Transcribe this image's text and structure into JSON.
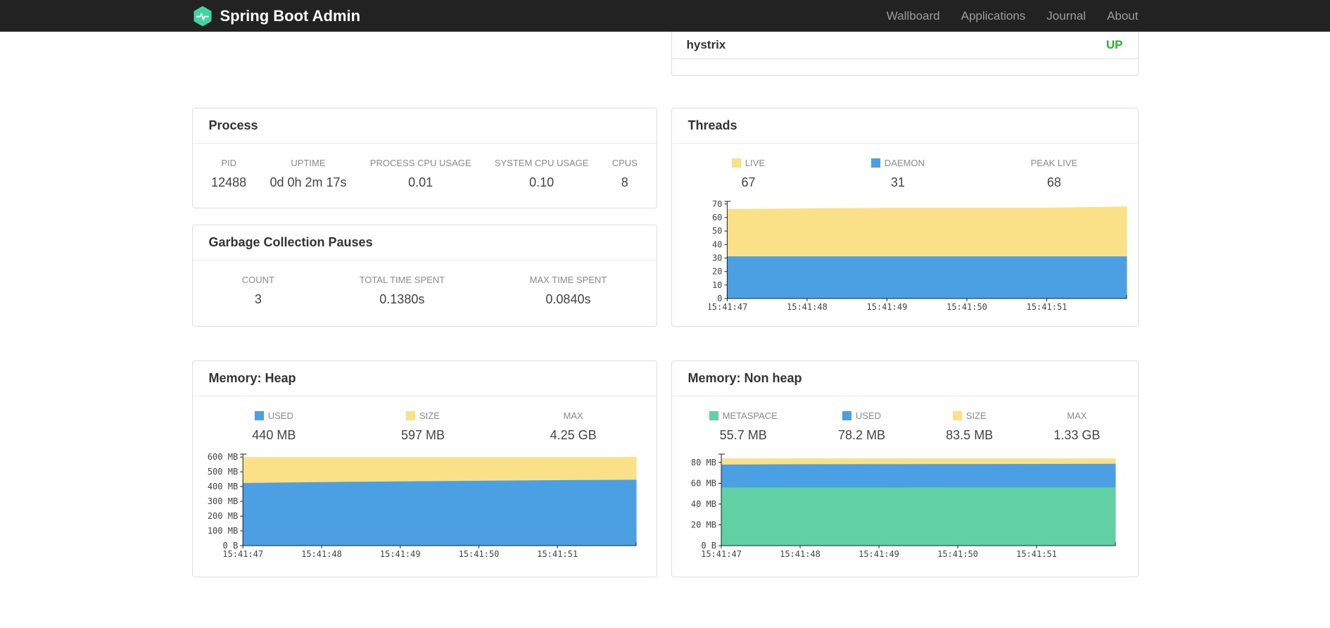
{
  "navbar": {
    "brand": "Spring Boot Admin",
    "items": [
      {
        "label": "Wallboard"
      },
      {
        "label": "Applications"
      },
      {
        "label": "Journal"
      },
      {
        "label": "About"
      }
    ]
  },
  "status_card": {
    "app_name": "hystrix",
    "status": "UP",
    "status_color": "#28b62c"
  },
  "colors": {
    "brand_green": "#42d3a2",
    "navbar_background": "#222222",
    "status_up": "#28b62c",
    "series_yellow": "#fae187",
    "series_blue": "#4aa0e2",
    "series_green": "#61d0a5"
  },
  "cards": {
    "process": {
      "title": "Process",
      "metrics": [
        {
          "label": "PID",
          "value": "12488"
        },
        {
          "label": "UPTIME",
          "value": "0d 0h 2m 17s"
        },
        {
          "label": "PROCESS CPU USAGE",
          "value": "0.01"
        },
        {
          "label": "SYSTEM CPU USAGE",
          "value": "0.10"
        },
        {
          "label": "CPUS",
          "value": "8"
        }
      ]
    },
    "gc": {
      "title": "Garbage Collection Pauses",
      "metrics": [
        {
          "label": "COUNT",
          "value": "3"
        },
        {
          "label": "TOTAL TIME SPENT",
          "value": "0.1380s"
        },
        {
          "label": "MAX TIME SPENT",
          "value": "0.0840s"
        }
      ]
    },
    "threads": {
      "title": "Threads",
      "legend": [
        {
          "label": "LIVE",
          "value": "67",
          "color": "#fae187"
        },
        {
          "label": "DAEMON",
          "value": "31",
          "color": "#4aa0e2"
        },
        {
          "label": "PEAK LIVE",
          "value": "68",
          "color": null
        }
      ]
    },
    "heap": {
      "title": "Memory: Heap",
      "legend": [
        {
          "label": "USED",
          "value": "440 MB",
          "color": "#4aa0e2"
        },
        {
          "label": "SIZE",
          "value": "597 MB",
          "color": "#fae187"
        },
        {
          "label": "MAX",
          "value": "4.25 GB",
          "color": null
        }
      ]
    },
    "nonheap": {
      "title": "Memory: Non heap",
      "legend": [
        {
          "label": "METASPACE",
          "value": "55.7 MB",
          "color": "#61d0a5"
        },
        {
          "label": "USED",
          "value": "78.2 MB",
          "color": "#4aa0e2"
        },
        {
          "label": "SIZE",
          "value": "83.5 MB",
          "color": "#fae187"
        },
        {
          "label": "MAX",
          "value": "1.33 GB",
          "color": null
        }
      ]
    }
  },
  "chart_data": [
    {
      "id": "threads",
      "type": "area",
      "title": "Threads",
      "x": [
        "15:41:47",
        "15:41:48",
        "15:41:49",
        "15:41:50",
        "15:41:51"
      ],
      "ylim": [
        0,
        72
      ],
      "yticks": [
        {
          "v": 0,
          "t": "0"
        },
        {
          "v": 10,
          "t": "10"
        },
        {
          "v": 20,
          "t": "20"
        },
        {
          "v": 30,
          "t": "30"
        },
        {
          "v": 40,
          "t": "40"
        },
        {
          "v": 50,
          "t": "50"
        },
        {
          "v": 60,
          "t": "60"
        },
        {
          "v": 70,
          "t": "70"
        }
      ],
      "series": [
        {
          "name": "LIVE",
          "color": "#fae187",
          "values": [
            66,
            66.5,
            67,
            67,
            67,
            68
          ]
        },
        {
          "name": "DAEMON",
          "color": "#4aa0e2",
          "values": [
            31,
            31,
            31,
            31,
            31,
            31
          ]
        }
      ]
    },
    {
      "id": "heap",
      "type": "area",
      "title": "Memory: Heap",
      "x": [
        "15:41:47",
        "15:41:48",
        "15:41:49",
        "15:41:50",
        "15:41:51"
      ],
      "ylim": [
        0,
        620
      ],
      "yticks": [
        {
          "v": 0,
          "t": "0 B"
        },
        {
          "v": 100,
          "t": "100 MB"
        },
        {
          "v": 200,
          "t": "200 MB"
        },
        {
          "v": 300,
          "t": "300 MB"
        },
        {
          "v": 400,
          "t": "400 MB"
        },
        {
          "v": 500,
          "t": "500 MB"
        },
        {
          "v": 600,
          "t": "600 MB"
        }
      ],
      "series": [
        {
          "name": "SIZE",
          "color": "#fae187",
          "values": [
            597,
            597,
            597,
            597,
            597,
            597
          ]
        },
        {
          "name": "USED",
          "color": "#4aa0e2",
          "values": [
            422,
            428,
            433,
            437,
            441,
            444
          ]
        }
      ]
    },
    {
      "id": "nonheap",
      "type": "area",
      "title": "Memory: Non heap",
      "x": [
        "15:41:47",
        "15:41:48",
        "15:41:49",
        "15:41:50",
        "15:41:51"
      ],
      "ylim": [
        0,
        88
      ],
      "yticks": [
        {
          "v": 0,
          "t": "0 B"
        },
        {
          "v": 20,
          "t": "20 MB"
        },
        {
          "v": 40,
          "t": "40 MB"
        },
        {
          "v": 60,
          "t": "60 MB"
        },
        {
          "v": 80,
          "t": "80 MB"
        }
      ],
      "series": [
        {
          "name": "SIZE",
          "color": "#fae187",
          "values": [
            83.5,
            83.5,
            83.5,
            83.5,
            83.5,
            83.5
          ]
        },
        {
          "name": "USED",
          "color": "#4aa0e2",
          "values": [
            77.6,
            77.9,
            78,
            78.1,
            78.2,
            78.3
          ]
        },
        {
          "name": "METASPACE",
          "color": "#61d0a5",
          "values": [
            55.5,
            55.6,
            55.6,
            55.7,
            55.7,
            55.7
          ]
        }
      ]
    }
  ]
}
